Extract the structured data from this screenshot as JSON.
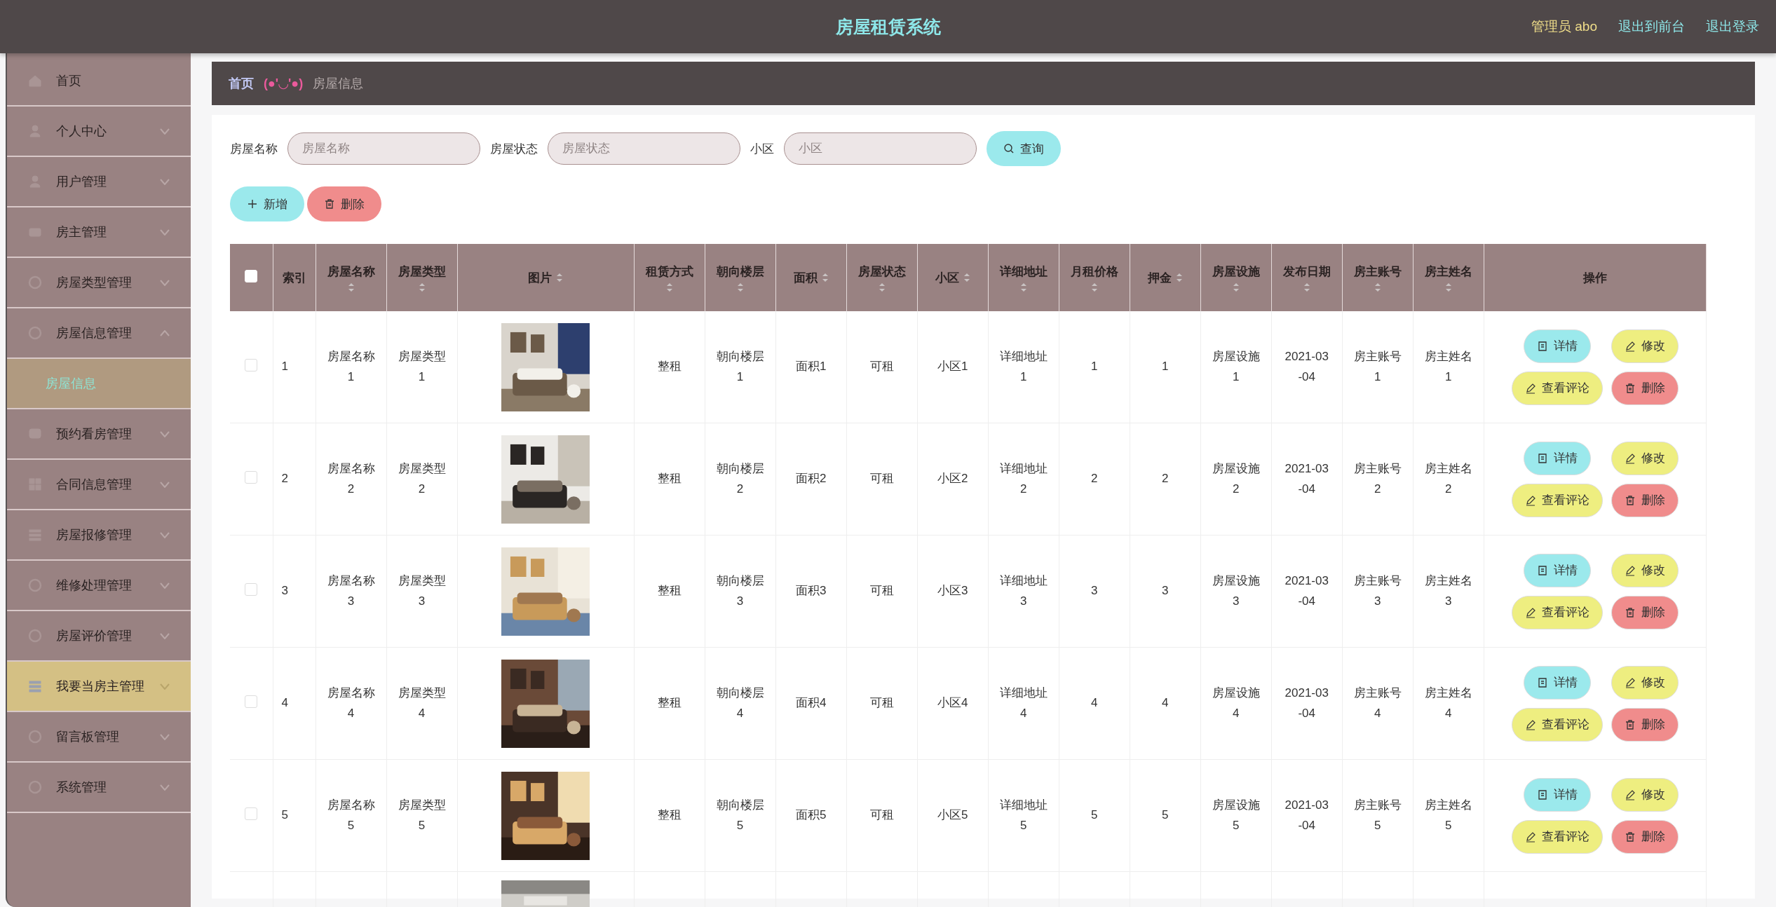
{
  "header": {
    "title": "房屋租赁系统",
    "user": "管理员 abo",
    "links": [
      "退出到前台",
      "退出登录"
    ]
  },
  "sidebar": {
    "items": [
      {
        "label": "首页",
        "has_submenu": false,
        "selected": false,
        "hovered": false
      },
      {
        "label": "个人中心",
        "has_submenu": true,
        "expanded": false,
        "selected": false,
        "hovered": false
      },
      {
        "label": "用户管理",
        "has_submenu": true,
        "expanded": false,
        "selected": false,
        "hovered": false
      },
      {
        "label": "房主管理",
        "has_submenu": true,
        "expanded": false,
        "selected": false,
        "hovered": false
      },
      {
        "label": "房屋类型管理",
        "has_submenu": true,
        "expanded": false,
        "selected": false,
        "hovered": false
      },
      {
        "label": "房屋信息管理",
        "has_submenu": true,
        "expanded": true,
        "selected": false,
        "hovered": false,
        "children": [
          {
            "label": "房屋信息",
            "selected": true
          }
        ]
      },
      {
        "label": "预约看房管理",
        "has_submenu": true,
        "expanded": false,
        "selected": false,
        "hovered": false
      },
      {
        "label": "合同信息管理",
        "has_submenu": true,
        "expanded": false,
        "selected": false,
        "hovered": false
      },
      {
        "label": "房屋报修管理",
        "has_submenu": true,
        "expanded": false,
        "selected": false,
        "hovered": false
      },
      {
        "label": "维修处理管理",
        "has_submenu": true,
        "expanded": false,
        "selected": false,
        "hovered": false
      },
      {
        "label": "房屋评价管理",
        "has_submenu": true,
        "expanded": false,
        "selected": false,
        "hovered": false
      },
      {
        "label": "我要当房主管理",
        "has_submenu": true,
        "expanded": false,
        "selected": false,
        "hovered": true
      },
      {
        "label": "留言板管理",
        "has_submenu": true,
        "expanded": false,
        "selected": false,
        "hovered": false
      },
      {
        "label": "系统管理",
        "has_submenu": true,
        "expanded": false,
        "selected": false,
        "hovered": false
      }
    ]
  },
  "breadcrumb": {
    "home": "首页",
    "separator": "(●'◡'●)",
    "current": "房屋信息"
  },
  "search": {
    "fields": [
      {
        "label": "房屋名称",
        "placeholder": "房屋名称"
      },
      {
        "label": "房屋状态",
        "placeholder": "房屋状态"
      },
      {
        "label": "小区",
        "placeholder": "小区"
      }
    ],
    "button": "查询"
  },
  "actions": [
    {
      "kind": "add",
      "label": "新增"
    },
    {
      "kind": "delete",
      "label": "删除"
    }
  ],
  "table": {
    "select_all_checked": false,
    "columns": [
      {
        "label": "索引",
        "sortable": false,
        "kind": "text"
      },
      {
        "label": "房屋名称",
        "sortable": true,
        "kind": "text"
      },
      {
        "label": "房屋类型",
        "sortable": true,
        "kind": "text"
      },
      {
        "label": "图片",
        "sortable": true,
        "kind": "picture"
      },
      {
        "label": "租赁方式",
        "sortable": true,
        "kind": "text"
      },
      {
        "label": "朝向楼层",
        "sortable": true,
        "kind": "text"
      },
      {
        "label": "面积",
        "sortable": true,
        "kind": "text"
      },
      {
        "label": "房屋状态",
        "sortable": true,
        "kind": "text"
      },
      {
        "label": "小区",
        "sortable": true,
        "kind": "text"
      },
      {
        "label": "详细地址",
        "sortable": true,
        "kind": "text"
      },
      {
        "label": "月租价格",
        "sortable": true,
        "kind": "text"
      },
      {
        "label": "押金",
        "sortable": true,
        "kind": "text"
      },
      {
        "label": "房屋设施",
        "sortable": true,
        "kind": "text"
      },
      {
        "label": "发布日期",
        "sortable": true,
        "kind": "date"
      },
      {
        "label": "房主账号",
        "sortable": true,
        "kind": "text"
      },
      {
        "label": "房主姓名",
        "sortable": true,
        "kind": "text"
      },
      {
        "label": "操作",
        "sortable": false,
        "kind": "actions"
      }
    ],
    "rows": [
      {
        "checked": false,
        "cells": [
          "1",
          "房屋名称1",
          "房屋类型1",
          {
            "kind": "picture"
          },
          "整租",
          "朝向楼层1",
          "面积1",
          "可租",
          "小区1",
          "详细地址1",
          "1",
          "1",
          "房屋设施1",
          "2021-03-04",
          "房主账号1",
          "房主姓名1"
        ],
        "actions": [
          {
            "kind": "detail",
            "label": "详情"
          },
          {
            "kind": "edit",
            "label": "修改"
          },
          {
            "kind": "comments",
            "label": "查看评论"
          },
          {
            "kind": "delete",
            "label": "删除"
          }
        ]
      },
      {
        "checked": false,
        "cells": [
          "2",
          "房屋名称2",
          "房屋类型2",
          {
            "kind": "picture"
          },
          "整租",
          "朝向楼层2",
          "面积2",
          "可租",
          "小区2",
          "详细地址2",
          "2",
          "2",
          "房屋设施2",
          "2021-03-04",
          "房主账号2",
          "房主姓名2"
        ],
        "actions": [
          {
            "kind": "detail",
            "label": "详情"
          },
          {
            "kind": "edit",
            "label": "修改"
          },
          {
            "kind": "comments",
            "label": "查看评论"
          },
          {
            "kind": "delete",
            "label": "删除"
          }
        ]
      },
      {
        "checked": false,
        "cells": [
          "3",
          "房屋名称3",
          "房屋类型3",
          {
            "kind": "picture"
          },
          "整租",
          "朝向楼层3",
          "面积3",
          "可租",
          "小区3",
          "详细地址3",
          "3",
          "3",
          "房屋设施3",
          "2021-03-04",
          "房主账号3",
          "房主姓名3"
        ],
        "actions": [
          {
            "kind": "detail",
            "label": "详情"
          },
          {
            "kind": "edit",
            "label": "修改"
          },
          {
            "kind": "comments",
            "label": "查看评论"
          },
          {
            "kind": "delete",
            "label": "删除"
          }
        ]
      },
      {
        "checked": false,
        "cells": [
          "4",
          "房屋名称4",
          "房屋类型4",
          {
            "kind": "picture"
          },
          "整租",
          "朝向楼层4",
          "面积4",
          "可租",
          "小区4",
          "详细地址4",
          "4",
          "4",
          "房屋设施4",
          "2021-03-04",
          "房主账号4",
          "房主姓名4"
        ],
        "actions": [
          {
            "kind": "detail",
            "label": "详情"
          },
          {
            "kind": "edit",
            "label": "修改"
          },
          {
            "kind": "comments",
            "label": "查看评论"
          },
          {
            "kind": "delete",
            "label": "删除"
          }
        ]
      },
      {
        "checked": false,
        "cells": [
          "5",
          "房屋名称5",
          "房屋类型5",
          {
            "kind": "picture"
          },
          "整租",
          "朝向楼层5",
          "面积5",
          "可租",
          "小区5",
          "详细地址5",
          "5",
          "5",
          "房屋设施5",
          "2021-03-04",
          "房主账号5",
          "房主姓名5"
        ],
        "actions": [
          {
            "kind": "detail",
            "label": "详情"
          },
          {
            "kind": "edit",
            "label": "修改"
          },
          {
            "kind": "comments",
            "label": "查看评论"
          },
          {
            "kind": "delete",
            "label": "删除"
          }
        ]
      }
    ],
    "partial_row": {
      "picture": {
        "kind": "picture"
      }
    }
  }
}
